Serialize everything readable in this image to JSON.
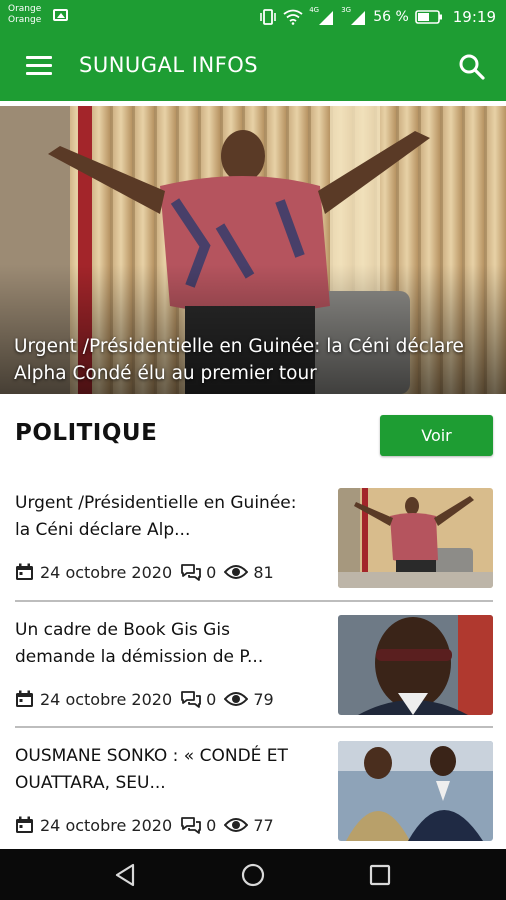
{
  "status_bar": {
    "carrier_line1": "Orange",
    "carrier_line2": "Orange",
    "battery": "56 %",
    "time": "19:19",
    "net1": "4G",
    "net2": "3G"
  },
  "app_bar": {
    "title": "SUNUGAL INFOS"
  },
  "featured": {
    "caption": "Urgent /Présidentielle en Guinée: la Céni déclare Alpha Condé élu au premier tour"
  },
  "section": {
    "title": "POLITIQUE",
    "button_label": "Voir"
  },
  "articles": [
    {
      "title": "Urgent /Présidentielle en Guinée: la Céni déclare Alp...",
      "date": "24 octobre 2020",
      "comments": "0",
      "views": "81"
    },
    {
      "title": "Un cadre de Book Gis Gis demande la démission de P...",
      "date": "24 octobre 2020",
      "comments": "0",
      "views": "79"
    },
    {
      "title": "OUSMANE SONKO : « CONDÉ ET OUATTARA, SEU...",
      "date": "24 octobre 2020",
      "comments": "0",
      "views": "77"
    }
  ],
  "colors": {
    "brand_green": "#1e9d33",
    "nav_bar": "#0a0a0a"
  },
  "icons": [
    "menu-icon",
    "search-icon",
    "calendar-icon",
    "comment-icon",
    "eye-icon",
    "back-icon",
    "home-icon",
    "recents-icon"
  ]
}
